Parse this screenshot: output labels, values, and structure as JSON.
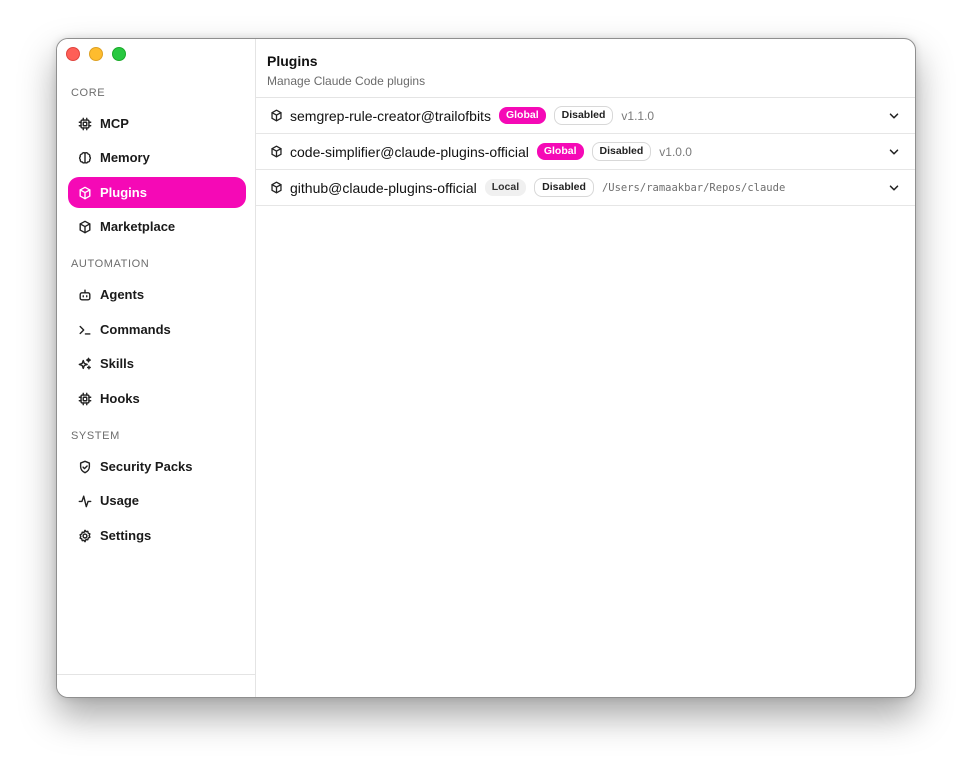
{
  "sidebar": {
    "sections": {
      "core": "CORE",
      "automation": "AUTOMATION",
      "system": "SYSTEM"
    },
    "items": {
      "mcp": "MCP",
      "memory": "Memory",
      "plugins": "Plugins",
      "marketplace": "Marketplace",
      "agents": "Agents",
      "commands": "Commands",
      "skills": "Skills",
      "hooks": "Hooks",
      "security_packs": "Security Packs",
      "usage": "Usage",
      "settings": "Settings"
    },
    "active": "plugins"
  },
  "header": {
    "title": "Plugins",
    "subtitle": "Manage Claude Code plugins"
  },
  "plugins": [
    {
      "name": "semgrep-rule-creator@trailofbits",
      "scope": "Global",
      "status": "Disabled",
      "meta": "v1.1.0"
    },
    {
      "name": "code-simplifier@claude-plugins-official",
      "scope": "Global",
      "status": "Disabled",
      "meta": "v1.0.0"
    },
    {
      "name": "github@claude-plugins-official",
      "scope": "Local",
      "status": "Disabled",
      "meta": "/Users/ramaakbar/Repos/claude"
    }
  ],
  "colors": {
    "accent": "#f509b6"
  }
}
